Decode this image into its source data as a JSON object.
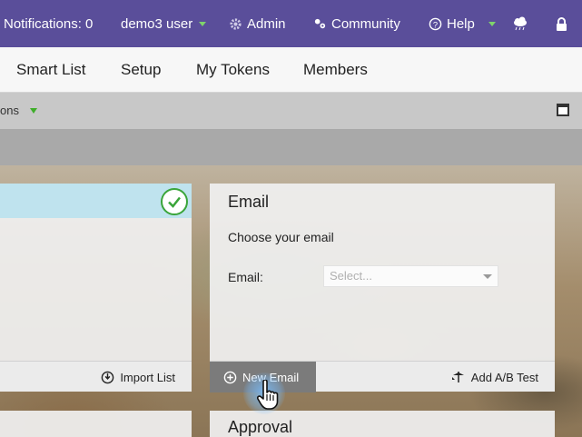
{
  "topbar": {
    "notifications": "Notifications: 0",
    "user": "demo3 user",
    "admin": "Admin",
    "community": "Community",
    "help": "Help",
    "bg_color": "#5a4e9a"
  },
  "tabs": [
    "Smart List",
    "Setup",
    "My Tokens",
    "Members"
  ],
  "toolbar": {
    "operations_partial": "ons"
  },
  "left_card": {
    "import_label": "Import List"
  },
  "email_card": {
    "title": "Email",
    "prompt": "Choose your email",
    "email_label": "Email:",
    "select_placeholder": "Select...",
    "new_email_label": "New Email",
    "ab_test_label": "Add A/B Test"
  },
  "approval_card": {
    "title": "Approval"
  }
}
